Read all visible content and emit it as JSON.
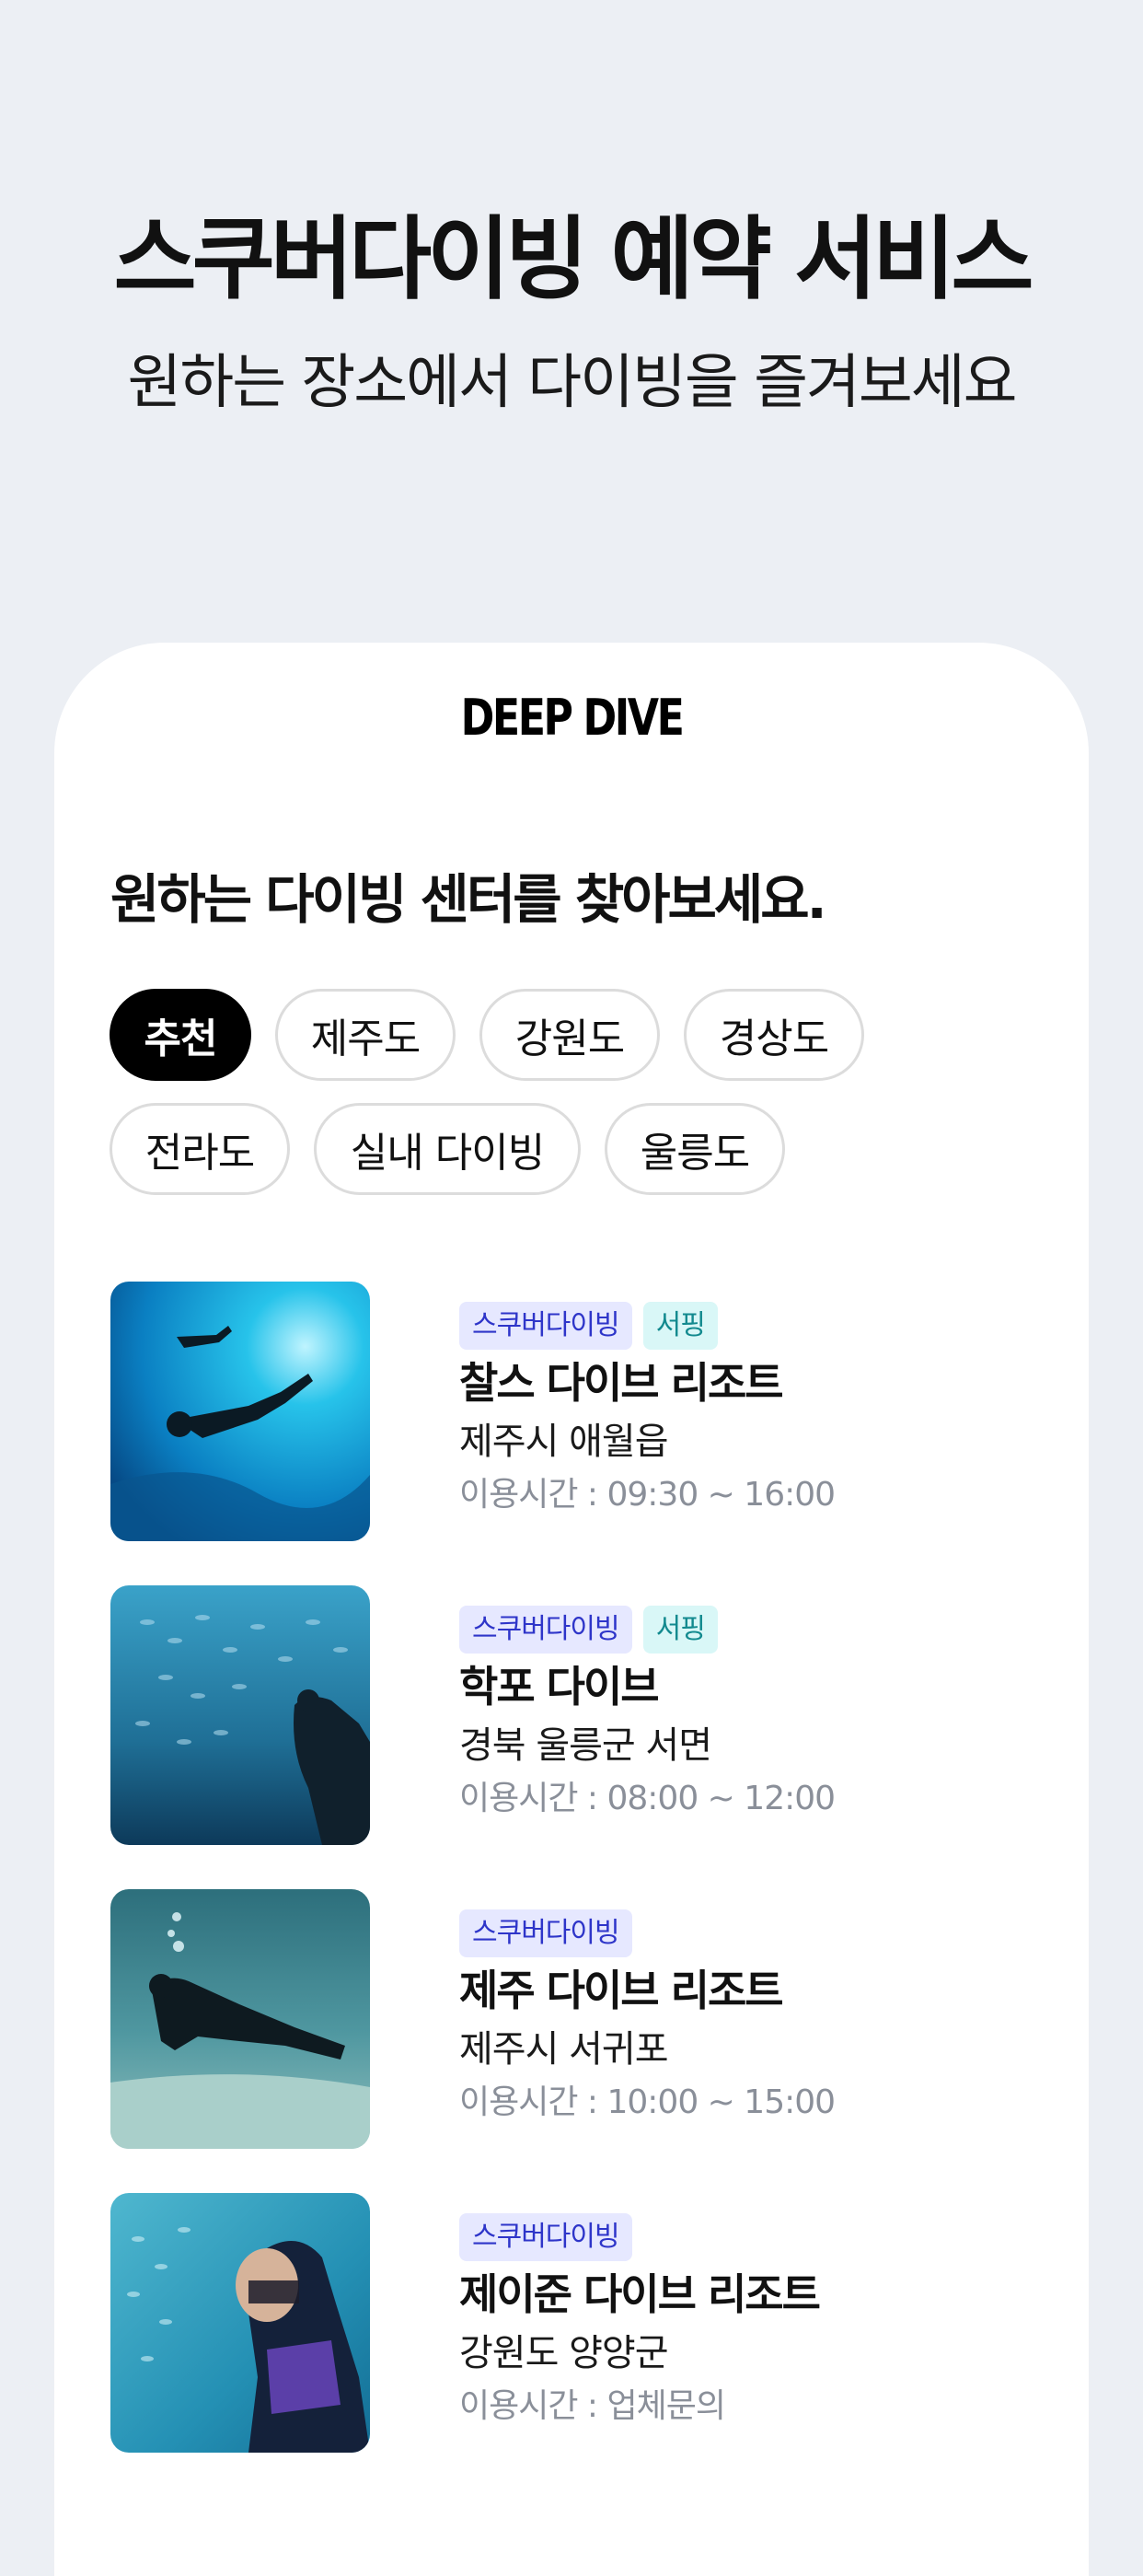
{
  "hero": {
    "title": "스쿠버다이빙 예약 서비스",
    "subtitle": "원하는 장소에서 다이빙을 즐겨보세요"
  },
  "app": {
    "brand": "DEEP DIVE",
    "section_title": "원하는 다이빙 센터를 찾아보세요.",
    "filters_row1": [
      "추천",
      "제주도",
      "강원도",
      "경상도"
    ],
    "filters_row2": [
      "전라도",
      "실내 다이빙",
      "울릉도"
    ],
    "active_filter": "추천",
    "centers": [
      {
        "tags": [
          "스쿠버다이빙",
          "서핑"
        ],
        "name": "찰스 다이브 리조트",
        "address": "제주시 애월읍",
        "hours": "이용시간 : 09:30 ~ 16:00",
        "image": "scuba-diver-photo"
      },
      {
        "tags": [
          "스쿠버다이빙",
          "서핑"
        ],
        "name": "학포 다이브",
        "address": "경북 울릉군 서면",
        "hours": "이용시간 : 08:00 ~ 12:00",
        "image": "fish-school-diver-photo"
      },
      {
        "tags": [
          "스쿠버다이빙"
        ],
        "name": "제주 다이브 리조트",
        "address": "제주시 서귀포",
        "hours": "이용시간 : 10:00 ~ 15:00",
        "image": "diver-seabed-photo"
      },
      {
        "tags": [
          "스쿠버다이빙"
        ],
        "name": "제이준 다이브 리조트",
        "address": "강원도 양양군",
        "hours": "이용시간 : 업체문의",
        "image": "diver-portrait-photo"
      }
    ]
  },
  "colors": {
    "background": "#eceff4",
    "scuba_tag_bg": "#e6e8ff",
    "scuba_tag_text": "#2e35c9",
    "surf_tag_bg": "#d9f7f7",
    "surf_tag_text": "#138a8f",
    "active_chip": "#000000"
  }
}
